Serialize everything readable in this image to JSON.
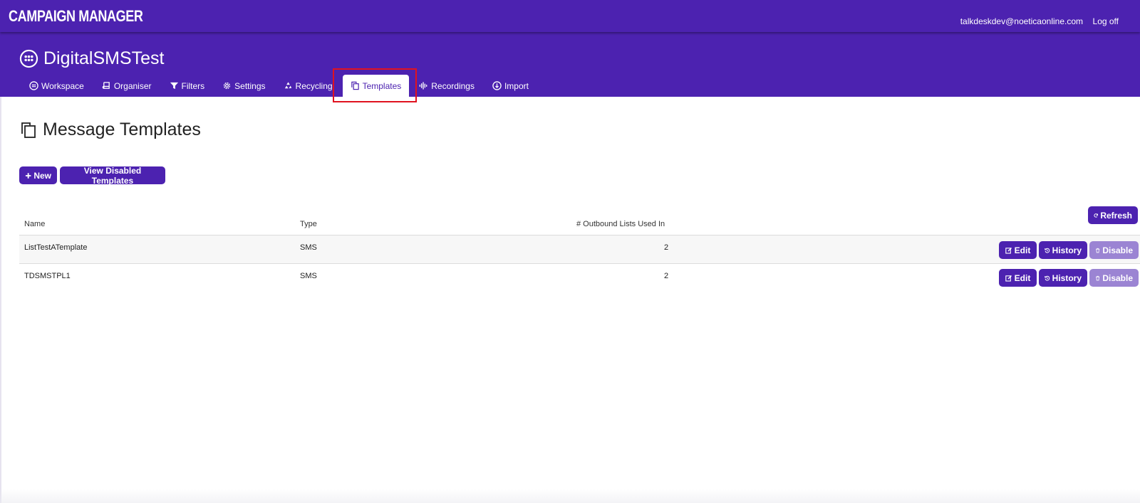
{
  "app": {
    "brand": "CAMPAIGN MANAGER",
    "user_email": "talkdeskdev@noeticaonline.com",
    "logoff_label": "Log off"
  },
  "project": {
    "name": "DigitalSMSTest"
  },
  "tabs": [
    {
      "label": "Workspace",
      "icon": "grid-circle-icon"
    },
    {
      "label": "Organiser",
      "icon": "book-icon"
    },
    {
      "label": "Filters",
      "icon": "filter-icon"
    },
    {
      "label": "Settings",
      "icon": "gear-icon"
    },
    {
      "label": "Recycling",
      "icon": "recycle-icon"
    },
    {
      "label": "Templates",
      "icon": "copy-icon",
      "active": true
    },
    {
      "label": "Recordings",
      "icon": "audio-wave-icon"
    },
    {
      "label": "Import",
      "icon": "import-circle-icon"
    }
  ],
  "page": {
    "title": "Message Templates",
    "new_button": "New",
    "view_disabled_button": "View Disabled Templates",
    "refresh_button": "Refresh"
  },
  "table": {
    "headers": [
      "Name",
      "Type",
      "# Outbound Lists Used In"
    ],
    "rows": [
      {
        "name": "ListTestATemplate",
        "type": "SMS",
        "count": "2"
      },
      {
        "name": "TDSMSTPL1",
        "type": "SMS",
        "count": "2"
      }
    ],
    "actions": {
      "edit": "Edit",
      "history": "History",
      "disable": "Disable"
    }
  },
  "colors": {
    "brand": "#4c22b0",
    "disabled_button": "#9b84d3",
    "highlight": "#e0121f"
  }
}
